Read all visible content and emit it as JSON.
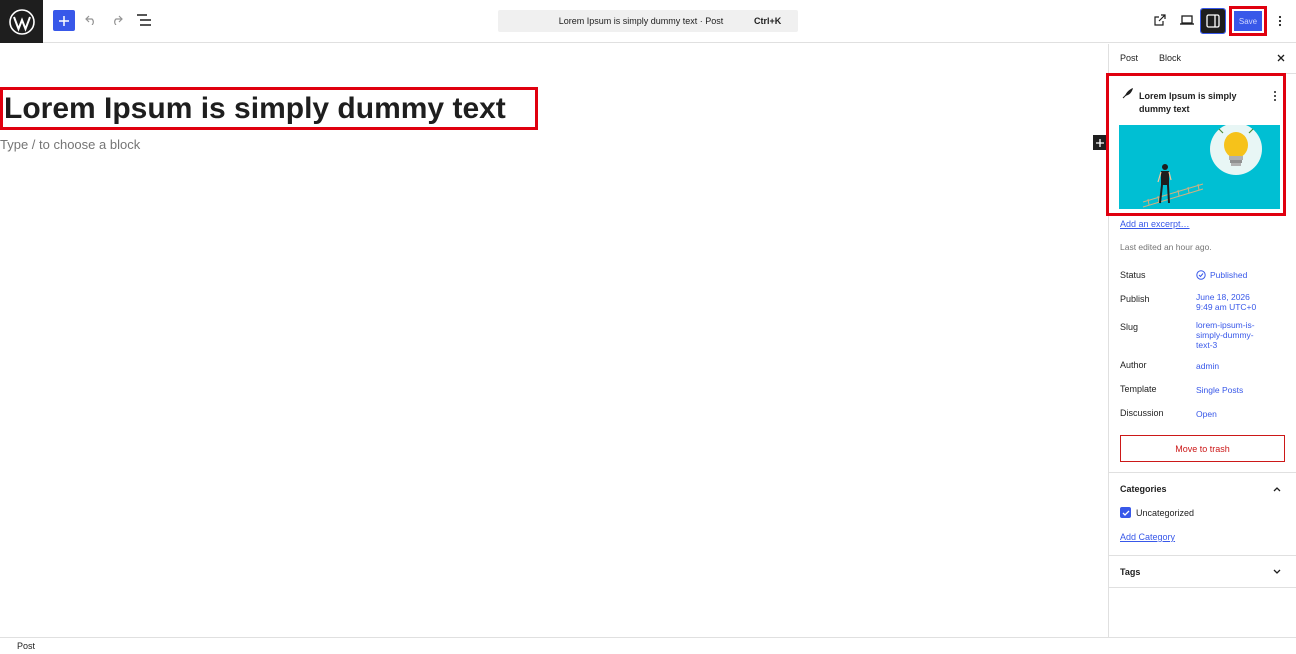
{
  "toolbar": {
    "logo_icon": "wordpress-icon",
    "add_icon": "plus-icon",
    "undo_icon": "undo-icon",
    "redo_icon": "redo-icon",
    "list_icon": "list-view-icon",
    "command_title": "Lorem Ipsum is simply dummy text · Post",
    "command_shortcut": "Ctrl+K",
    "view_icon": "external-link-icon",
    "preview_icon": "desktop-icon",
    "settings_icon": "sidebar-toggle-icon",
    "save_label": "Save",
    "more_icon": "more-vertical-icon"
  },
  "editor": {
    "title": "Lorem Ipsum is simply dummy text",
    "placeholder": "Type / to choose a block",
    "inserter_icon": "plus-icon"
  },
  "sidebar": {
    "tabs": [
      "Post",
      "Block"
    ],
    "close_icon": "close-icon",
    "card": {
      "icon": "feather-icon",
      "title": "Lorem Ipsum is simply dummy text",
      "more_icon": "more-vertical-icon",
      "image": "featured-image-lightbulb-illustration"
    },
    "excerpt_link": "Add an excerpt…",
    "last_edited": "Last edited an hour ago.",
    "fields": [
      {
        "label": "Status",
        "value": "Published"
      },
      {
        "label": "Publish",
        "value_line1": "June 18, 2026",
        "value_line2": "9:49 am UTC+0"
      },
      {
        "label": "Slug",
        "value_line1": "lorem-ipsum-is-",
        "value_line2": "simply-dummy-",
        "value_line3": "text-3"
      },
      {
        "label": "Author",
        "value": "admin"
      },
      {
        "label": "Template",
        "value": "Single Posts"
      },
      {
        "label": "Discussion",
        "value": "Open"
      }
    ],
    "trash_label": "Move to trash",
    "categories": {
      "heading": "Categories",
      "items": [
        {
          "label": "Uncategorized",
          "checked": true
        }
      ],
      "add_link": "Add Category"
    },
    "tags": {
      "heading": "Tags"
    }
  },
  "footer": {
    "breadcrumb": "Post"
  },
  "colors": {
    "accent": "#3858e9",
    "highlight": "#e0000f",
    "danger": "#cc1818",
    "image_bg": "#00bfd3"
  }
}
